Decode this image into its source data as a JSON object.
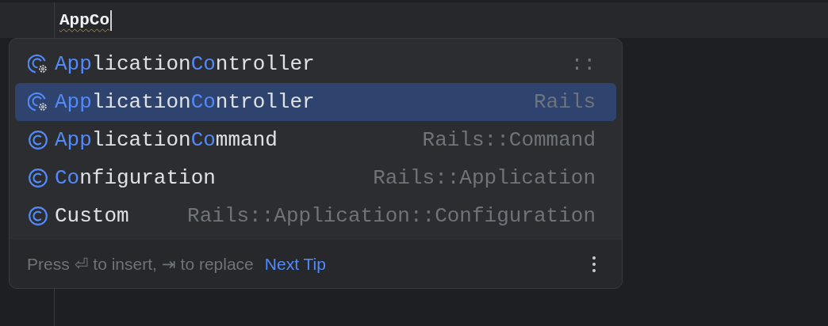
{
  "editor": {
    "typed_text": "AppCo",
    "warning": true
  },
  "completion": {
    "items": [
      {
        "kind": "class_settings",
        "selected": false,
        "name": "**App**lication**Co**ntroller",
        "location": "::"
      },
      {
        "kind": "class_settings",
        "selected": true,
        "name": "**App**lication**Co**ntroller",
        "location": "Rails"
      },
      {
        "kind": "class",
        "selected": false,
        "name": "**App**lication**Co**mmand",
        "location": "Rails::Command"
      },
      {
        "kind": "class",
        "selected": false,
        "name": "**Co**nfiguration",
        "location": "Rails::Application"
      },
      {
        "kind": "class",
        "selected": false,
        "name": "Custom",
        "location": "Rails::Application::Configuration"
      }
    ],
    "footer": {
      "hint": "Press ⏎ to insert, ⇥ to replace",
      "link": "Next Tip"
    }
  }
}
